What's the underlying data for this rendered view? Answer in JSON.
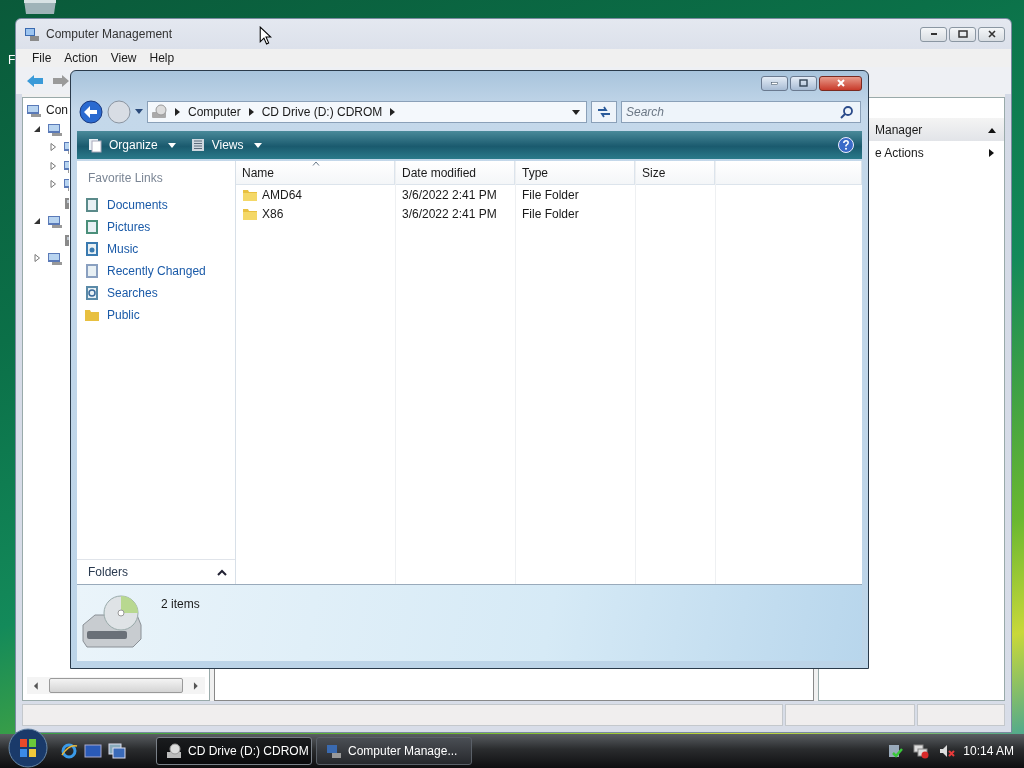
{
  "desktop": {
    "icon_label": "F"
  },
  "back_window": {
    "title": "Computer Management",
    "menu": [
      "File",
      "Action",
      "View",
      "Help"
    ],
    "tree": [
      {
        "label": "Con",
        "children": [
          {
            "expanded": true,
            "children": [
              {
                "expanded": false
              },
              {
                "expanded": false
              },
              {
                "expanded": false
              },
              {
                "kind": "leaf"
              }
            ]
          },
          {
            "expanded": true,
            "children": [
              {
                "kind": "leaf"
              }
            ]
          },
          {
            "expanded": false
          }
        ]
      }
    ],
    "actions": [
      {
        "kind": "header",
        "label": "Manager"
      },
      {
        "kind": "submenu",
        "label": "e Actions"
      }
    ]
  },
  "explorer": {
    "path": [
      "Computer",
      "CD Drive (D:) CDROM"
    ],
    "search": {
      "placeholder": "Search"
    },
    "toolbar": [
      "Organize",
      "Views"
    ],
    "nav_title": "Favorite Links",
    "links": [
      "Documents",
      "Pictures",
      "Music",
      "Recently Changed",
      "Searches",
      "Public"
    ],
    "folders_label": "Folders",
    "columns": [
      {
        "label": "Name",
        "sorted": true
      },
      {
        "label": "Date modified",
        "sorted": false
      },
      {
        "label": "Type",
        "sorted": false
      },
      {
        "label": "Size",
        "sorted": false
      }
    ],
    "rows": [
      {
        "name": "AMD64",
        "date": "3/6/2022 2:41 PM",
        "type": "File Folder"
      },
      {
        "name": "X86",
        "date": "3/6/2022 2:41 PM",
        "type": "File Folder"
      }
    ],
    "details": "2 items"
  },
  "taskbar": {
    "tasks": [
      {
        "label": "CD Drive (D:) CDROM",
        "selected": true
      },
      {
        "label": "Computer Manage...",
        "selected": false
      }
    ],
    "clock": "10:14 AM"
  }
}
